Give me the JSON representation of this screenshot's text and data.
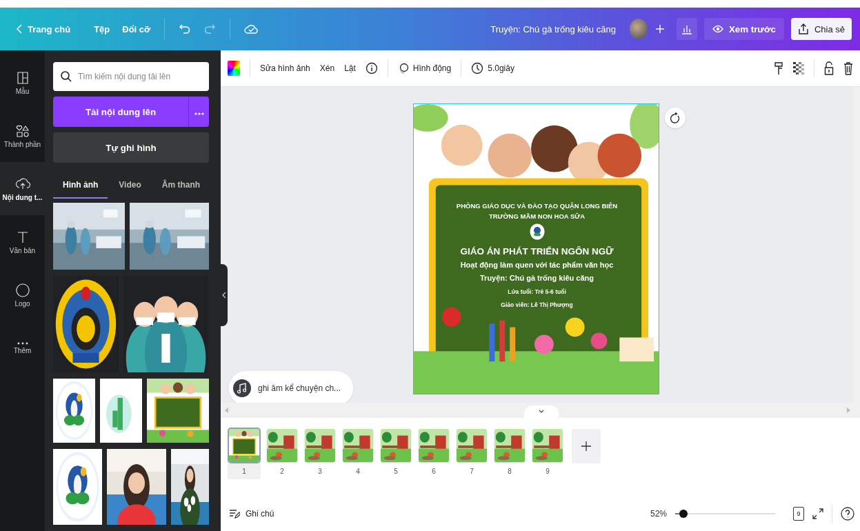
{
  "topbar": {
    "back": "Trang chủ",
    "menu": [
      "Tệp",
      "Đổi cỡ"
    ],
    "title": "Truyện: Chú gà trống kiêu căng",
    "preview": "Xem trước",
    "share": "Chia sẻ"
  },
  "rail": [
    {
      "label": "Mẫu",
      "selected": false
    },
    {
      "label": "Thành phần",
      "selected": false
    },
    {
      "label": "Nội dung t...",
      "selected": true
    },
    {
      "label": "Văn bản",
      "selected": false
    },
    {
      "label": "Logo",
      "selected": false
    },
    {
      "label": "Thêm",
      "selected": false
    }
  ],
  "panel": {
    "search_placeholder": "Tìm kiếm nội dung tải lên",
    "upload": "Tải nội dung lên",
    "record": "Tự ghi hình",
    "tabs": [
      {
        "label": "Hình ảnh",
        "selected": true
      },
      {
        "label": "Video",
        "selected": false
      },
      {
        "label": "Âm thanh",
        "selected": false
      }
    ]
  },
  "toolbar": {
    "items": [
      "Sửa hình ảnh",
      "Xén",
      "Lật"
    ],
    "animate": "Hình động",
    "duration": "5.0giây"
  },
  "slide": {
    "lines": [
      {
        "kind": "org",
        "text": "PHÒNG GIÁO DỤC VÀ ĐÀO TẠO QUẬN LONG BIÊN"
      },
      {
        "kind": "org",
        "text": "TRƯỜNG MẦM NON HOA SỮA"
      },
      {
        "kind": "logo"
      },
      {
        "kind": "title",
        "text": "GIÁO ÁN PHÁT TRIỂN NGÔN NGỮ"
      },
      {
        "kind": "subtitle",
        "text": "Hoạt động làm quen với tác phẩm văn học"
      },
      {
        "kind": "subtitle",
        "text": "Truyện: Chú gà trống kiêu căng"
      },
      {
        "kind": "meta",
        "text": "Lứa tuổi: Trẻ 5-6 tuổi"
      },
      {
        "kind": "meta",
        "text": "Giáo viên: Lê Thị Phượng"
      }
    ]
  },
  "audio": {
    "label": "ghi âm kể chuyện ch..."
  },
  "pages": [
    {
      "number": "1",
      "selected": true
    },
    {
      "number": "2",
      "selected": false
    },
    {
      "number": "3",
      "selected": false
    },
    {
      "number": "4",
      "selected": false
    },
    {
      "number": "5",
      "selected": false
    },
    {
      "number": "6",
      "selected": false
    },
    {
      "number": "7",
      "selected": false
    },
    {
      "number": "8",
      "selected": false
    },
    {
      "number": "9",
      "selected": false
    }
  ],
  "footer": {
    "notes": "Ghi chú",
    "zoom": "52%",
    "level": 0.08,
    "page_count": "9"
  }
}
